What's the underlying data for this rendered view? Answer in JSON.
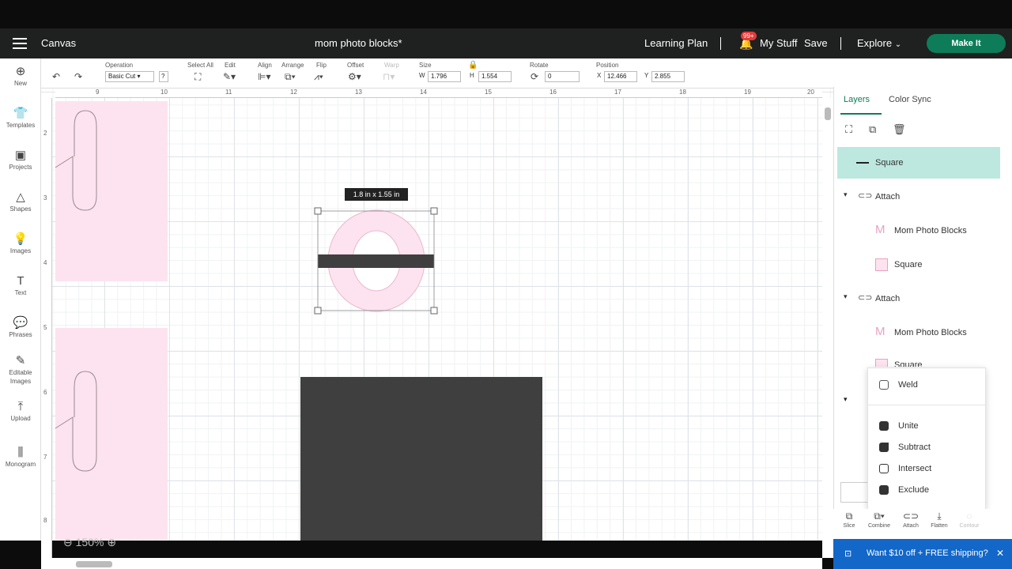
{
  "topbar": {
    "app_title": "Canvas",
    "project_title": "mom photo blocks*",
    "learning_plan": "Learning Plan",
    "badge": "99+",
    "my_stuff": "My Stuff",
    "save": "Save",
    "explore": "Explore",
    "make_it": "Make It"
  },
  "toolbar": {
    "operation_label": "Operation",
    "operation_value": "Basic Cut",
    "select_all": "Select All",
    "edit": "Edit",
    "align": "Align",
    "arrange": "Arrange",
    "flip": "Flip",
    "offset": "Offset",
    "warp": "Warp",
    "size": "Size",
    "w_label": "W",
    "w_value": "1.796",
    "h_label": "H",
    "h_value": "1.554",
    "rotate": "Rotate",
    "rotate_value": "0",
    "position": "Position",
    "x_label": "X",
    "x_value": "12.466",
    "y_label": "Y",
    "y_value": "2.855"
  },
  "sidebar": {
    "items": [
      {
        "label": "New",
        "icon": "plus-circle-icon"
      },
      {
        "label": "Templates",
        "icon": "shirt-icon"
      },
      {
        "label": "Projects",
        "icon": "projects-icon"
      },
      {
        "label": "Shapes",
        "icon": "shapes-icon"
      },
      {
        "label": "Images",
        "icon": "bulb-icon"
      },
      {
        "label": "Text",
        "icon": "text-icon"
      },
      {
        "label": "Phrases",
        "icon": "speech-icon"
      },
      {
        "label": "Editable Images",
        "icon": "editable-icon"
      },
      {
        "label": "Upload",
        "icon": "upload-icon"
      },
      {
        "label": "Monogram",
        "icon": "monogram-icon"
      }
    ]
  },
  "rulers": {
    "top": [
      "9",
      "10",
      "11",
      "12",
      "13",
      "14",
      "15",
      "16",
      "17",
      "18",
      "19",
      "20"
    ],
    "left": [
      "2",
      "3",
      "4",
      "5",
      "6",
      "7",
      "8"
    ]
  },
  "canvas": {
    "size_tooltip": "1.8  in x 1.55  in",
    "zoom": "150%"
  },
  "panel": {
    "tabs": [
      "Layers",
      "Color Sync"
    ],
    "layers": [
      {
        "label": "Square",
        "type": "selected"
      },
      {
        "label": "Attach",
        "type": "group"
      },
      {
        "label": "Mom Photo Blocks",
        "type": "child-m"
      },
      {
        "label": "Square",
        "type": "child-sq"
      },
      {
        "label": "Attach",
        "type": "group"
      },
      {
        "label": "Mom Photo Blocks",
        "type": "child-m"
      },
      {
        "label": "Square",
        "type": "child-sq"
      }
    ]
  },
  "combine_menu": {
    "items": [
      "Weld",
      "Unite",
      "Subtract",
      "Intersect",
      "Exclude"
    ]
  },
  "bottom_tools": [
    "Slice",
    "Combine",
    "Attach",
    "Flatten",
    "Contour"
  ],
  "promo": {
    "text": "Want $10 off + FREE shipping?"
  },
  "colors": {
    "accent": "#0e7c59",
    "pink": "#fde3ef",
    "dark_shape": "#3f3f3f",
    "promo": "#1267c8"
  }
}
